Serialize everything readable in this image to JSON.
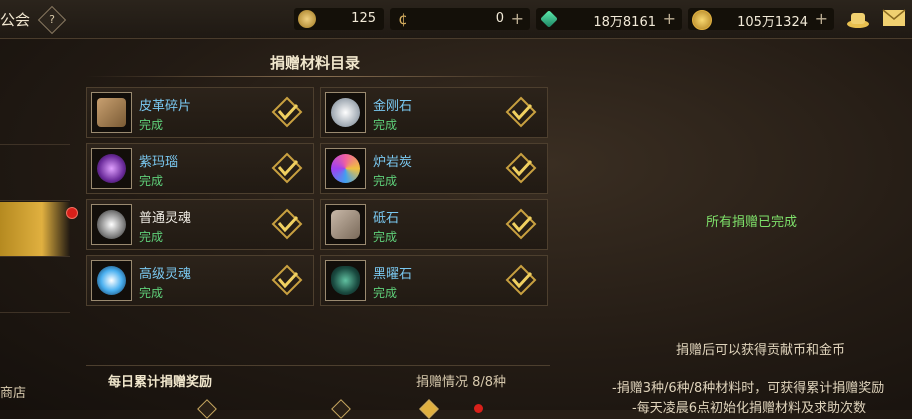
{
  "header": {
    "title": "公会",
    "help_icon": "?",
    "resources": [
      {
        "name": "stamina",
        "icon": "sun-coin-icon",
        "value": "125",
        "plus": false
      },
      {
        "name": "contribution",
        "icon": "c-coin-icon",
        "value": "0",
        "plus": true
      },
      {
        "name": "crystal",
        "icon": "green-crystal-icon",
        "value": "18万8161",
        "plus": true
      },
      {
        "name": "gold",
        "icon": "gold-coin-icon",
        "value": "105万1324",
        "plus": true
      }
    ],
    "icons": [
      "hat-icon",
      "mail-icon"
    ]
  },
  "sidebar": {
    "shop_label": "商店"
  },
  "panel": {
    "title": "捐赠材料目录",
    "items": [
      {
        "name": "皮革碎片",
        "status": "完成",
        "icon": "leather-scrap-icon",
        "name_color": "#7ac8f0"
      },
      {
        "name": "金刚石",
        "status": "完成",
        "icon": "diamond-icon",
        "name_color": "#7ac8f0"
      },
      {
        "name": "紫玛瑙",
        "status": "完成",
        "icon": "purple-agate-icon",
        "name_color": "#7ac8f0"
      },
      {
        "name": "炉岩炭",
        "status": "完成",
        "icon": "furnace-rock-charcoal-icon",
        "name_color": "#7ac8f0"
      },
      {
        "name": "普通灵魂",
        "status": "完成",
        "icon": "common-soul-icon",
        "name_color": "#f0ece4"
      },
      {
        "name": "砥石",
        "status": "完成",
        "icon": "whetstone-icon",
        "name_color": "#7ac8f0"
      },
      {
        "name": "高级灵魂",
        "status": "完成",
        "icon": "advanced-soul-icon",
        "name_color": "#7ac8f0"
      },
      {
        "name": "黑曜石",
        "status": "完成",
        "icon": "obsidian-icon",
        "name_color": "#7ac8f0"
      }
    ]
  },
  "right": {
    "all_done": "所有捐赠已完成",
    "reward_info": "捐赠后可以获得贡献币和金币",
    "rule1": "-捐赠3种/6种/8种材料时，可获得累计捐赠奖励",
    "rule2": "-每天凌晨6点初始化捐赠材料及求助次数"
  },
  "bottom": {
    "daily_label": "每日累计捐赠奖励",
    "donate_status": "捐赠情况 8/8种"
  },
  "colors": {
    "accent_gold": "#e0b040",
    "done_green": "#5fd07a",
    "all_done_green": "#7ee06a",
    "name_blue": "#7ac8f0"
  }
}
